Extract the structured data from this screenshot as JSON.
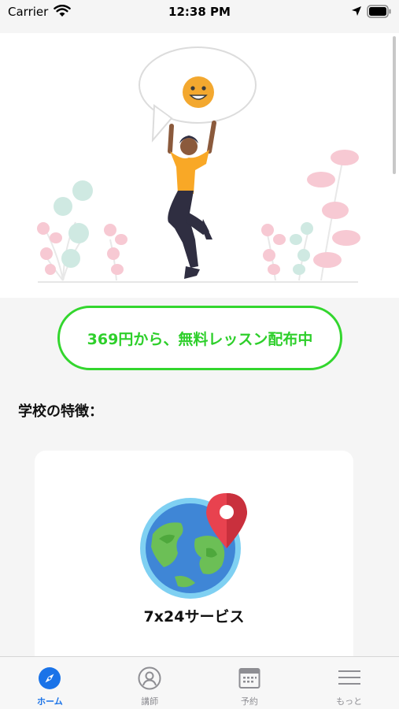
{
  "status_bar": {
    "carrier": "Carrier",
    "time": "12:38 PM"
  },
  "promo": {
    "label": "369円から、無料レッスン配布中"
  },
  "section": {
    "title": "学校の特徴："
  },
  "feature": {
    "label": "7x24サービス",
    "icon": "globe-location-pin-icon"
  },
  "tabs": [
    {
      "label": "ホーム",
      "icon": "compass-icon",
      "active": true
    },
    {
      "label": "講師",
      "icon": "person-icon",
      "active": false
    },
    {
      "label": "予約",
      "icon": "calendar-icon",
      "active": false
    },
    {
      "label": "もっと",
      "icon": "menu-icon",
      "active": false
    }
  ],
  "colors": {
    "accent_green": "#33d62e",
    "tab_active": "#1a73e8",
    "tab_inactive": "#8e8e93"
  }
}
